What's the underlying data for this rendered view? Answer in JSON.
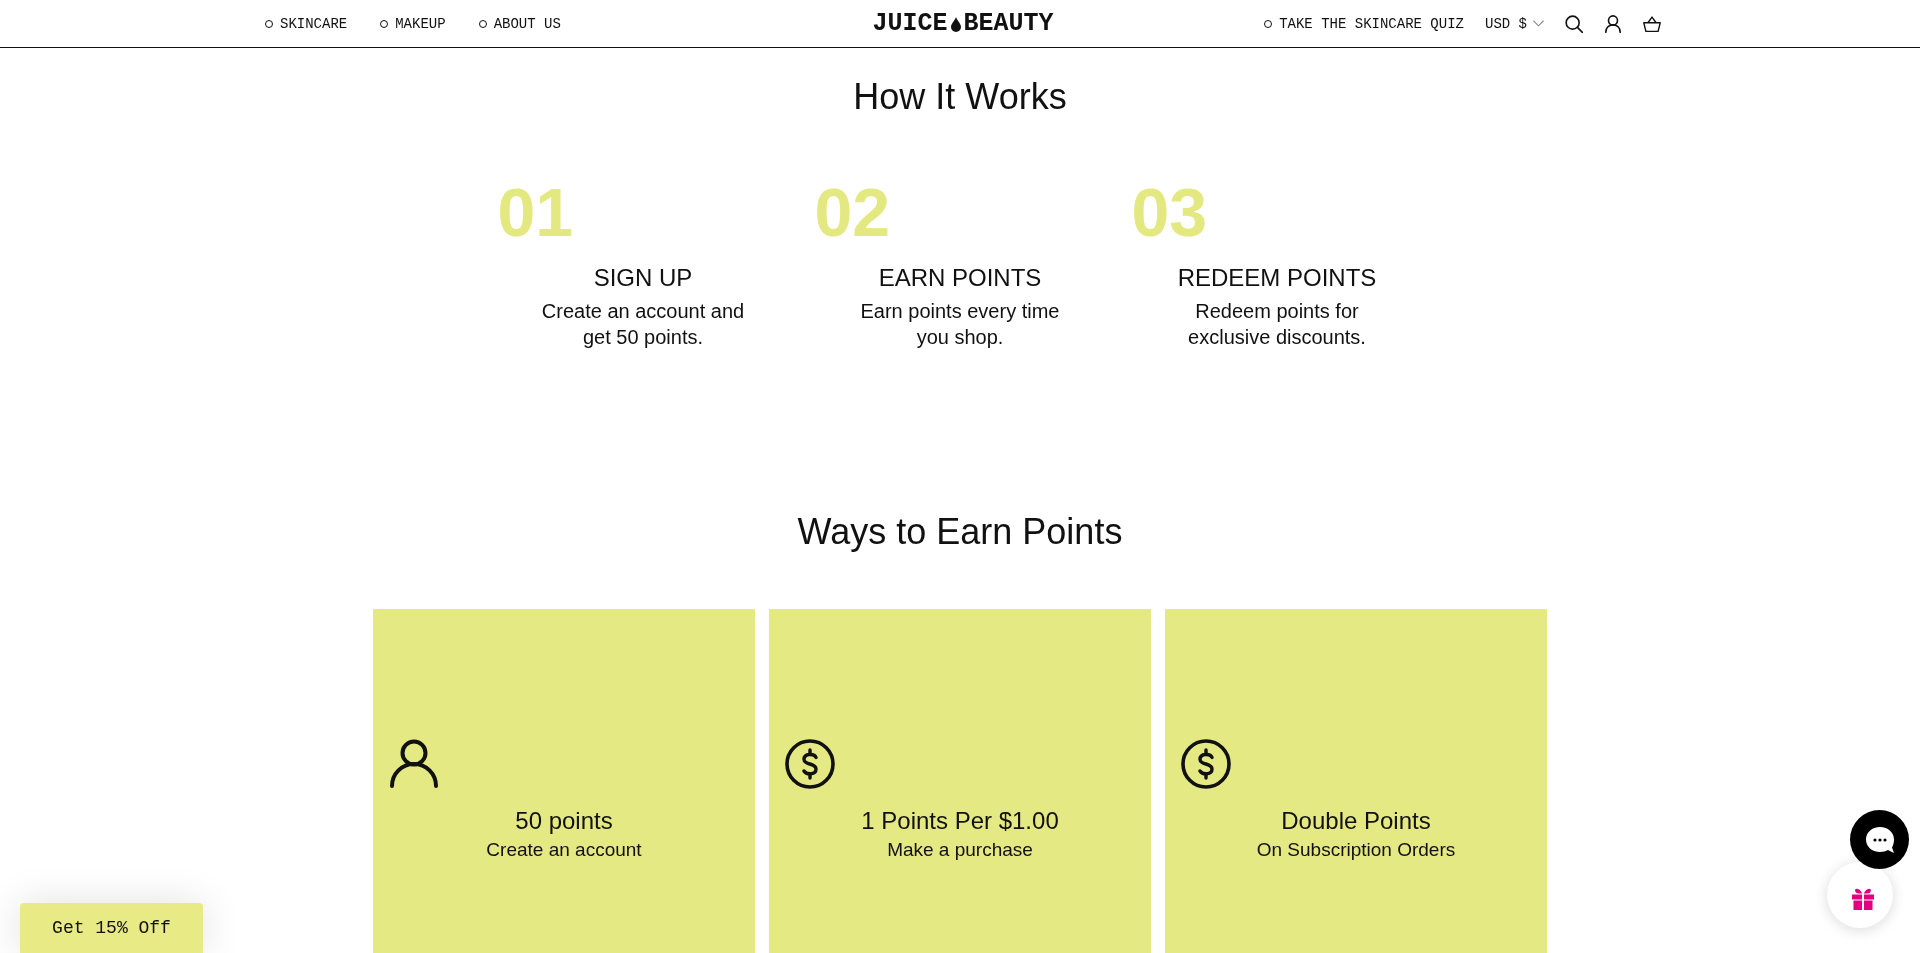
{
  "header": {
    "nav_left": [
      {
        "label": "SKINCARE"
      },
      {
        "label": "MAKEUP"
      },
      {
        "label": "ABOUT US"
      }
    ],
    "logo": {
      "left": "JUICE",
      "right": "BEAUTY"
    },
    "quiz_link": "TAKE THE SKINCARE QUIZ",
    "currency": "USD $"
  },
  "how_it_works": {
    "title": "How It Works",
    "steps": [
      {
        "number": "01",
        "title": "SIGN UP",
        "description": "Create an account and get 50 points."
      },
      {
        "number": "02",
        "title": "EARN POINTS",
        "description": "Earn points every time you shop."
      },
      {
        "number": "03",
        "title": "REDEEM POINTS",
        "description": "Redeem points for exclusive discounts."
      }
    ]
  },
  "ways_to_earn": {
    "title": "Ways to Earn Points",
    "cards": [
      {
        "kind": "account",
        "title": "50 points",
        "subtitle": "Create an account"
      },
      {
        "kind": "dollar",
        "title": "1 Points Per $1.00",
        "subtitle": "Make a purchase"
      },
      {
        "kind": "dollar",
        "title": "Double Points",
        "subtitle": "On Subscription Orders"
      }
    ]
  },
  "promo_button": "Get 15% Off"
}
